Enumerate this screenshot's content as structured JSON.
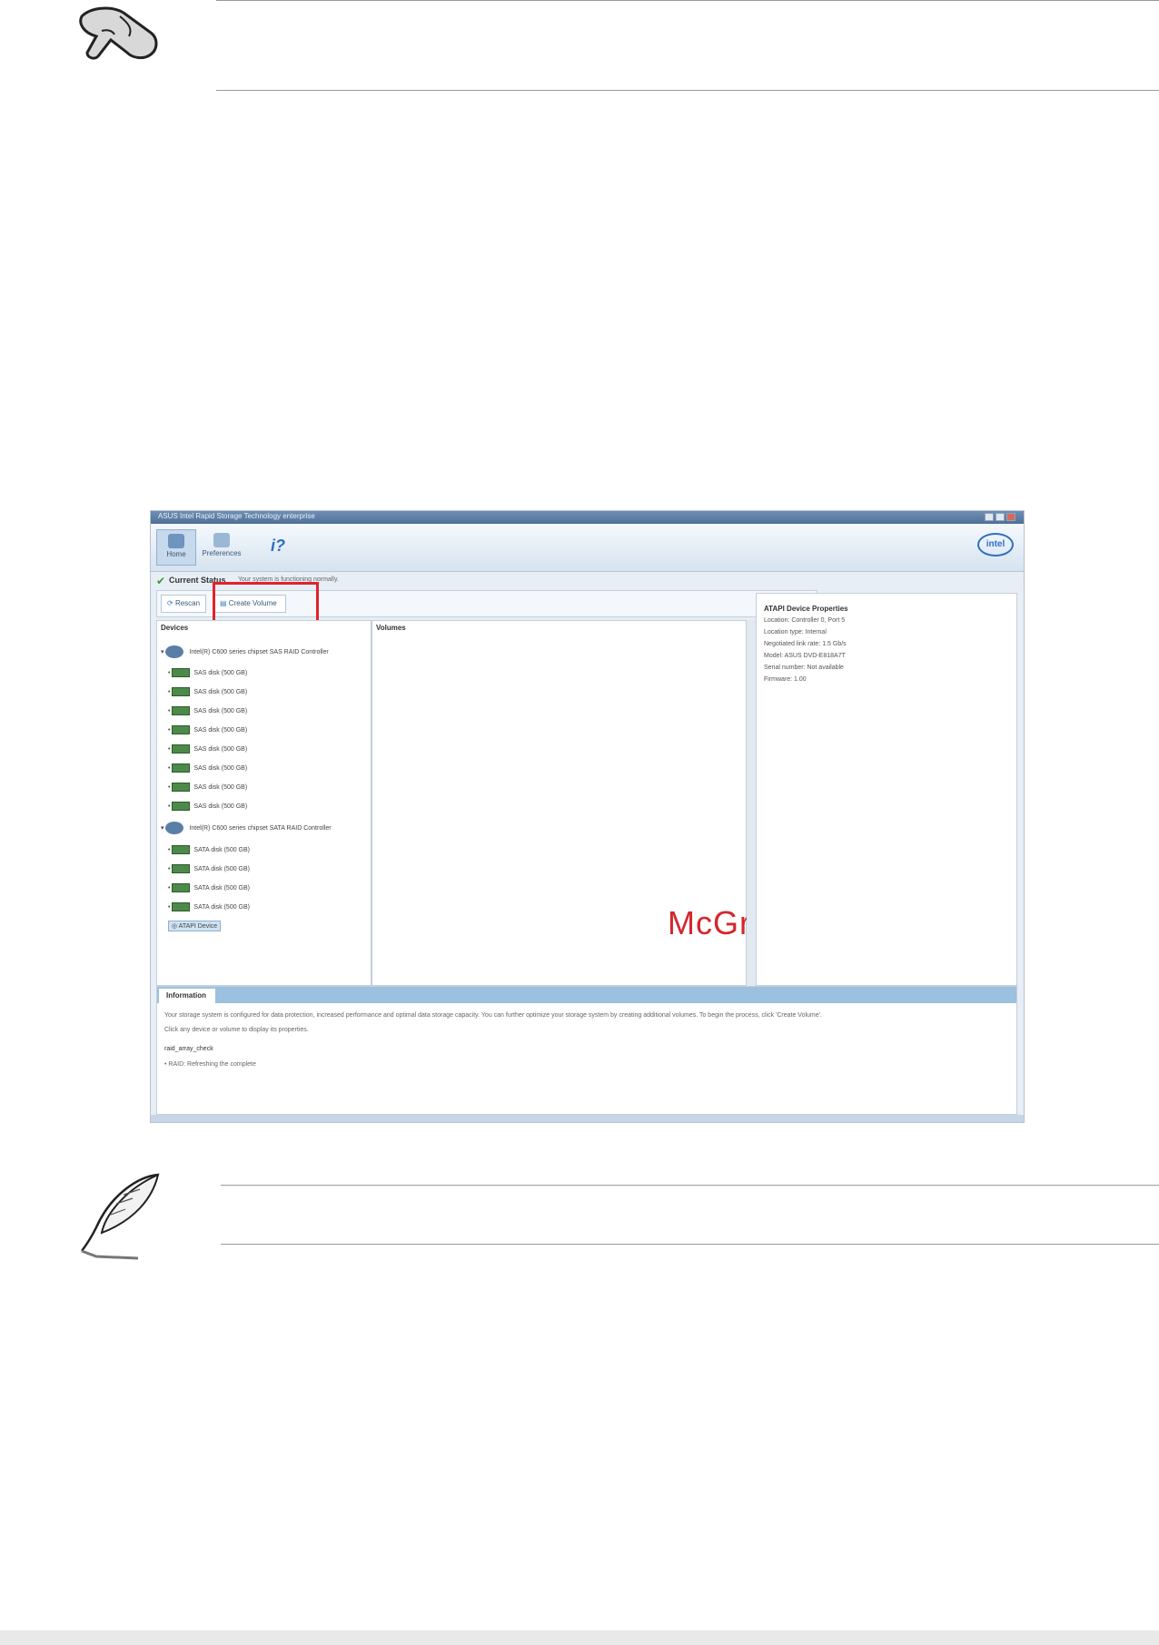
{
  "window": {
    "title": "ASUS Intel Rapid Storage Technology enterprise",
    "ribbon_tabs": [
      "Home",
      "Preferences"
    ],
    "help_icon": "help-icon",
    "logo_text": "intel"
  },
  "status": {
    "title": "Current Status",
    "subtitle": "Your system is functioning normally."
  },
  "toolbar": {
    "refresh_label": "Rescan",
    "create_label": "Create Volume"
  },
  "devices": {
    "header": "Devices",
    "controllers": [
      {
        "name": "Intel(R) C600 series chipset SAS RAID Controller",
        "disks": [
          "SAS disk (500 GB)",
          "SAS disk (500 GB)",
          "SAS disk (500 GB)",
          "SAS disk (500 GB)",
          "SAS disk (500 GB)",
          "SAS disk (500 GB)",
          "SAS disk (500 GB)",
          "SAS disk (500 GB)"
        ]
      },
      {
        "name": "Intel(R) C600 series chipset SATA RAID Controller",
        "disks": [
          "SATA disk (500 GB)",
          "SATA disk (500 GB)",
          "SATA disk (500 GB)",
          "SATA disk (500 GB)",
          "ATAPI Device"
        ]
      }
    ]
  },
  "volumes": {
    "header": "Volumes"
  },
  "watermark": "McGrp.Ru",
  "properties": {
    "title": "ATAPI Device Properties",
    "rows": [
      "Location: Controller 0, Port 5",
      "Location type: Internal",
      "Negotiated link rate: 1.5 Gb/s",
      "Model: ASUS DVD-E818A7T",
      "Serial number: Not available",
      "Firmware: 1.00"
    ]
  },
  "information": {
    "tab": "Information",
    "text1": "Your storage system is configured for data protection, increased performance and optimal data storage capacity. You can further optimize your storage system by creating additional volumes. To begin the process, click 'Create Volume'.",
    "text2": "Click any device or volume to display its properties.",
    "log_name": "raid_array_check",
    "log_entry": "• RAID: Refreshing the complete"
  }
}
